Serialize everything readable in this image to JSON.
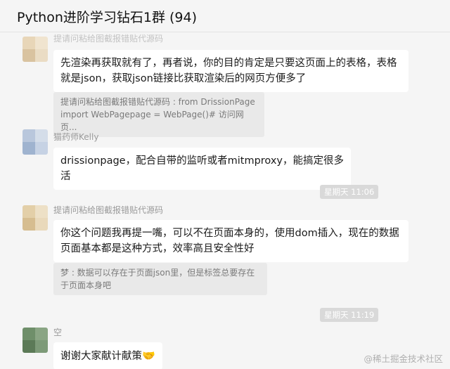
{
  "window": {
    "title": "Python进阶学习钻石1群 (94)"
  },
  "messages": [
    {
      "sender": "提请问粘给图截报错贴代源码",
      "text": "先渲染再获取就有了，再者说，你的目的肯定是只要这页面上的表格，表格就是json，获取json链接比获取渲染后的网页方便多了",
      "quote": "提请问粘给图截报错贴代源码 : from DrissionPage import WebPagepage = WebPage()# 访问网页..."
    },
    {
      "sender": "猫药师Kelly",
      "text": "drissionpage，配合自带的监听或者mitmproxy，能搞定很多活",
      "time": "星期天 11:06"
    },
    {
      "sender": "提请问粘给图截报错贴代源码",
      "text": "你这个问题我再提一嘴，可以不在页面本身的，使用dom插入，现在的数据页面基本都是这种方式，效率高且安全性好",
      "quote": "梦 : 数据可以存在于页面json里，但是标签总要存在于页面本身吧",
      "time": "星期天 11:19"
    },
    {
      "sender": "空",
      "text": "谢谢大家献计献策",
      "emoji": "🤝"
    }
  ],
  "watermark": "@稀土掘金技术社区"
}
